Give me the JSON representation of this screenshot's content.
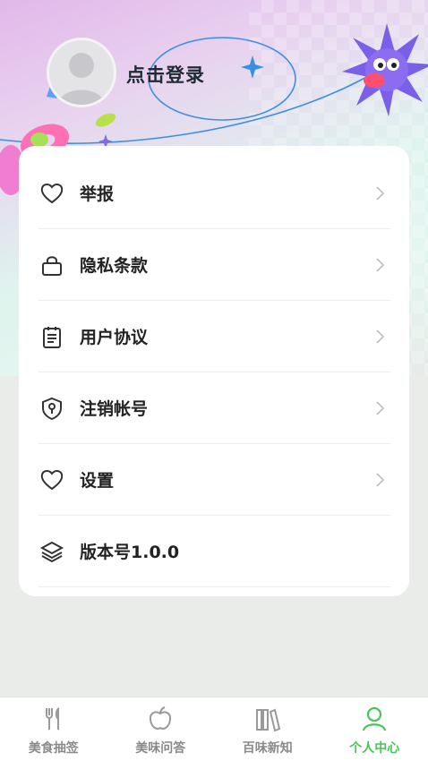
{
  "header": {
    "login_label": "点击登录"
  },
  "menu": {
    "items": [
      {
        "label": "举报",
        "icon": "heart-icon"
      },
      {
        "label": "隐私条款",
        "icon": "lock-icon"
      },
      {
        "label": "用户协议",
        "icon": "clipboard-icon"
      },
      {
        "label": "注销帐号",
        "icon": "shield-icon"
      },
      {
        "label": "设置",
        "icon": "heart-icon"
      },
      {
        "label": "版本号1.0.0",
        "icon": "layers-icon"
      }
    ]
  },
  "tabbar": {
    "tabs": [
      {
        "label": "美食抽签",
        "icon": "utensils-icon",
        "active": false
      },
      {
        "label": "美味问答",
        "icon": "apple-icon",
        "active": false
      },
      {
        "label": "百味新知",
        "icon": "books-icon",
        "active": false
      },
      {
        "label": "个人中心",
        "icon": "person-icon",
        "active": true
      }
    ]
  },
  "colors": {
    "accent": "#4cc35a",
    "inactive": "#8a8a8a"
  }
}
